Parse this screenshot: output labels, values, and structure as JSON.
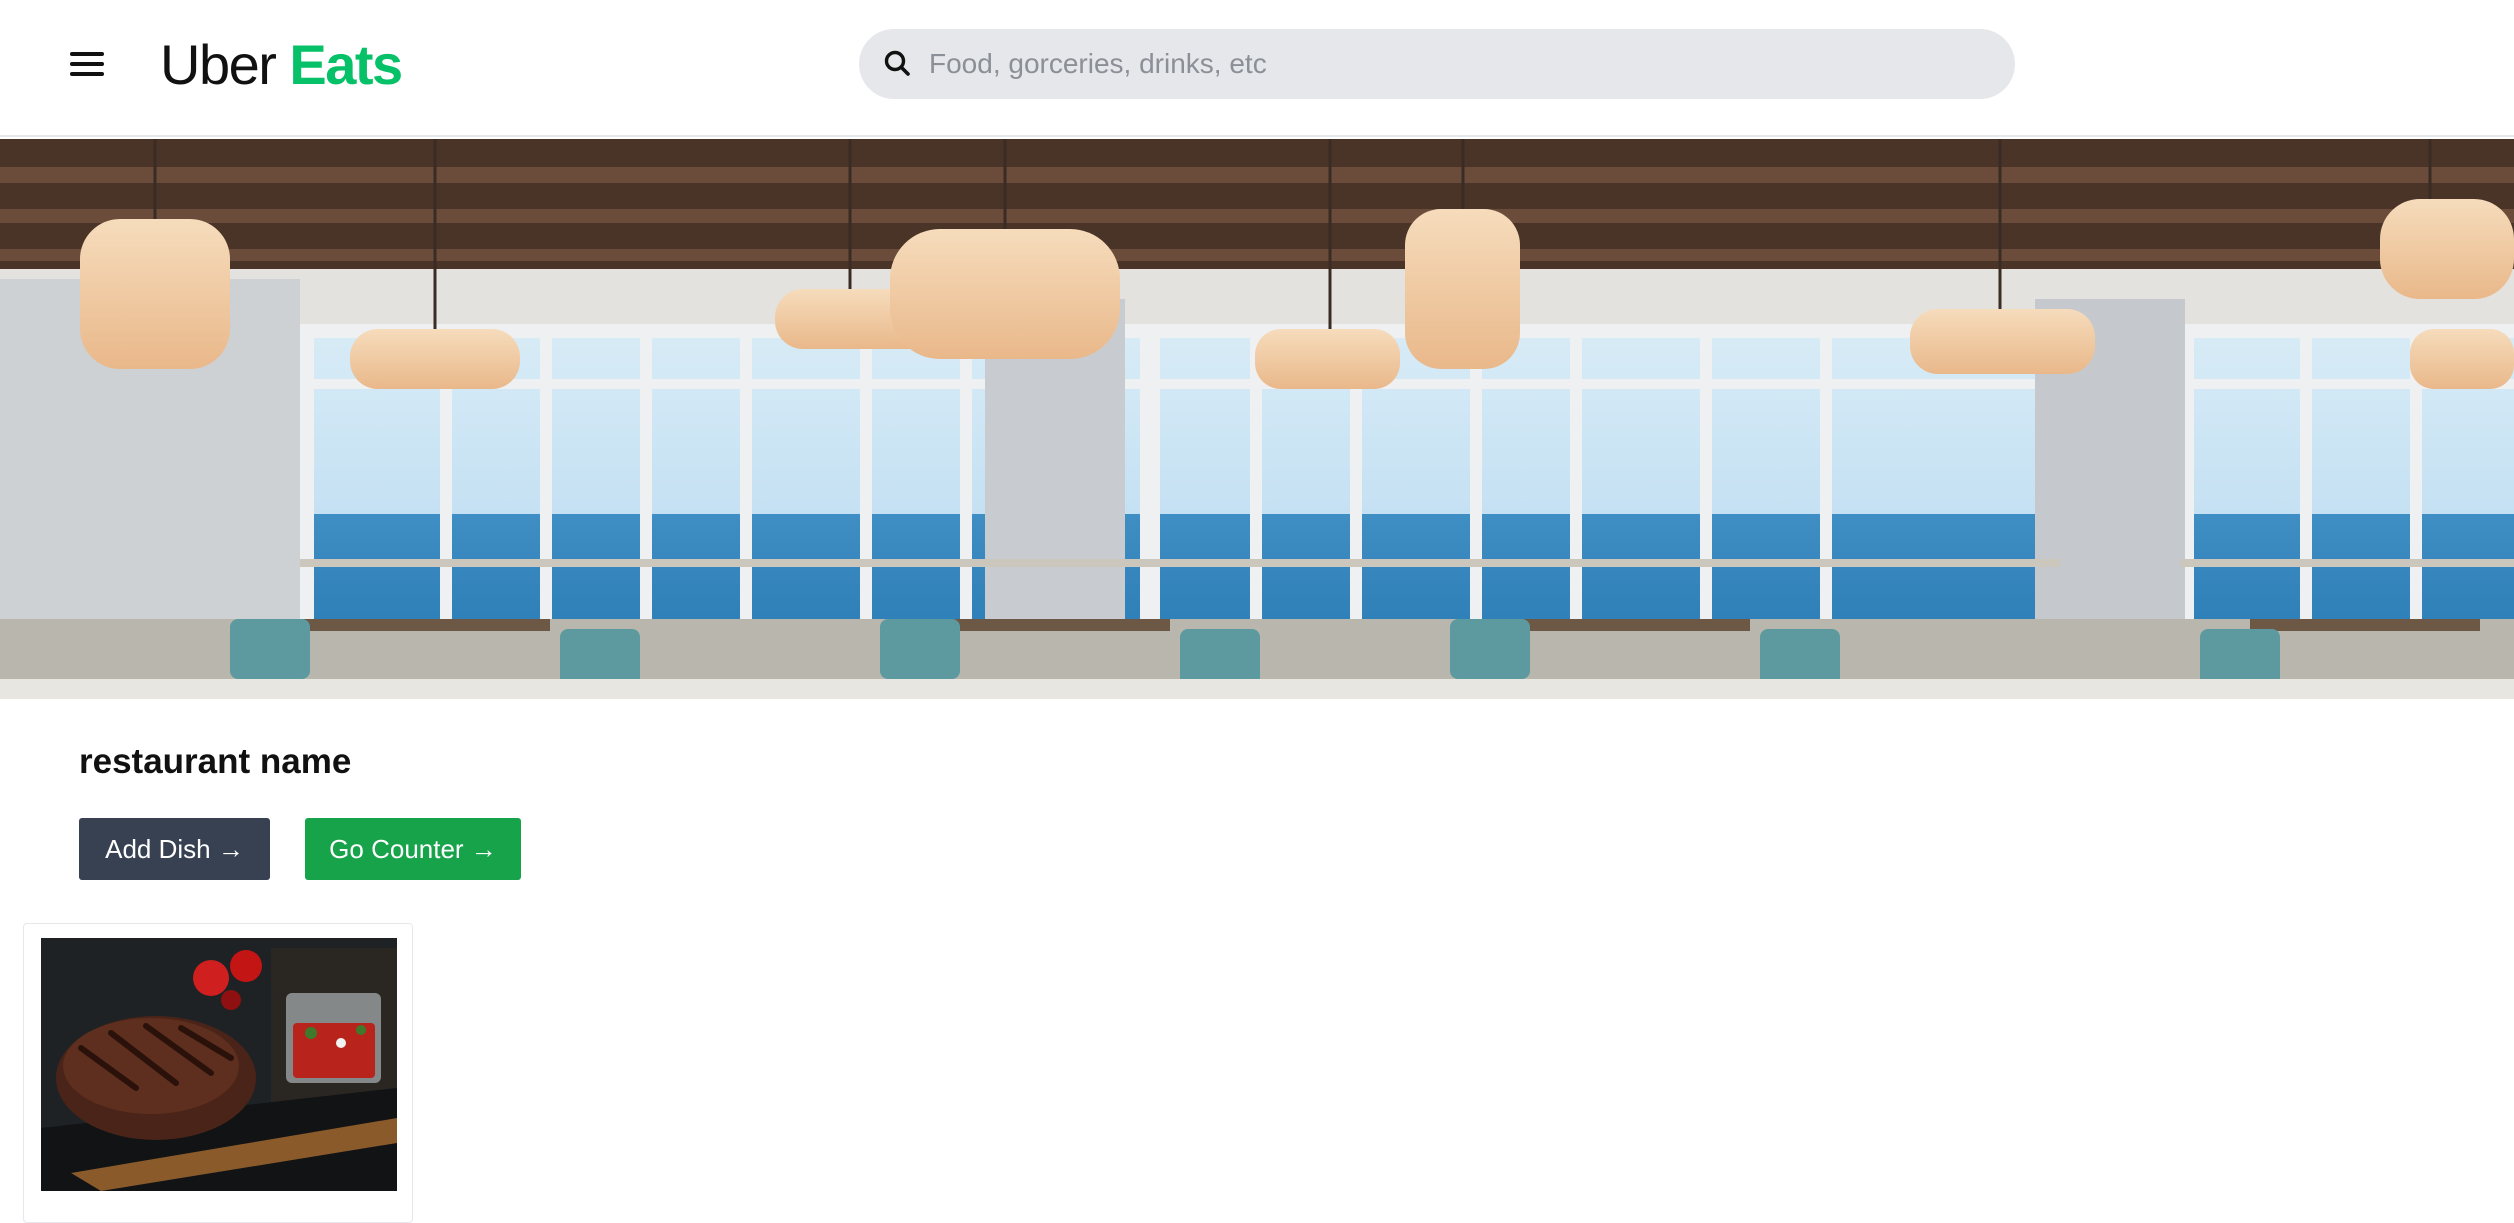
{
  "brand": {
    "part1": "Uber",
    "part2": "Eats",
    "accent_color": "#06c167"
  },
  "header": {
    "menu_icon": "hamburger-menu-icon",
    "search": {
      "placeholder": "Food, gorceries, drinks, etc",
      "value": "",
      "icon": "search-icon"
    }
  },
  "hero": {
    "image": "restaurant-interior-ocean-view"
  },
  "restaurant": {
    "name": "restaurant name"
  },
  "actions": {
    "add_dish_label": "Add Dish →",
    "go_counter_label": "Go Counter →",
    "add_dish_color": "#374151",
    "go_counter_color": "#16a34a"
  },
  "dishes": [
    {
      "image": "grilled-steak-with-salsa"
    }
  ]
}
